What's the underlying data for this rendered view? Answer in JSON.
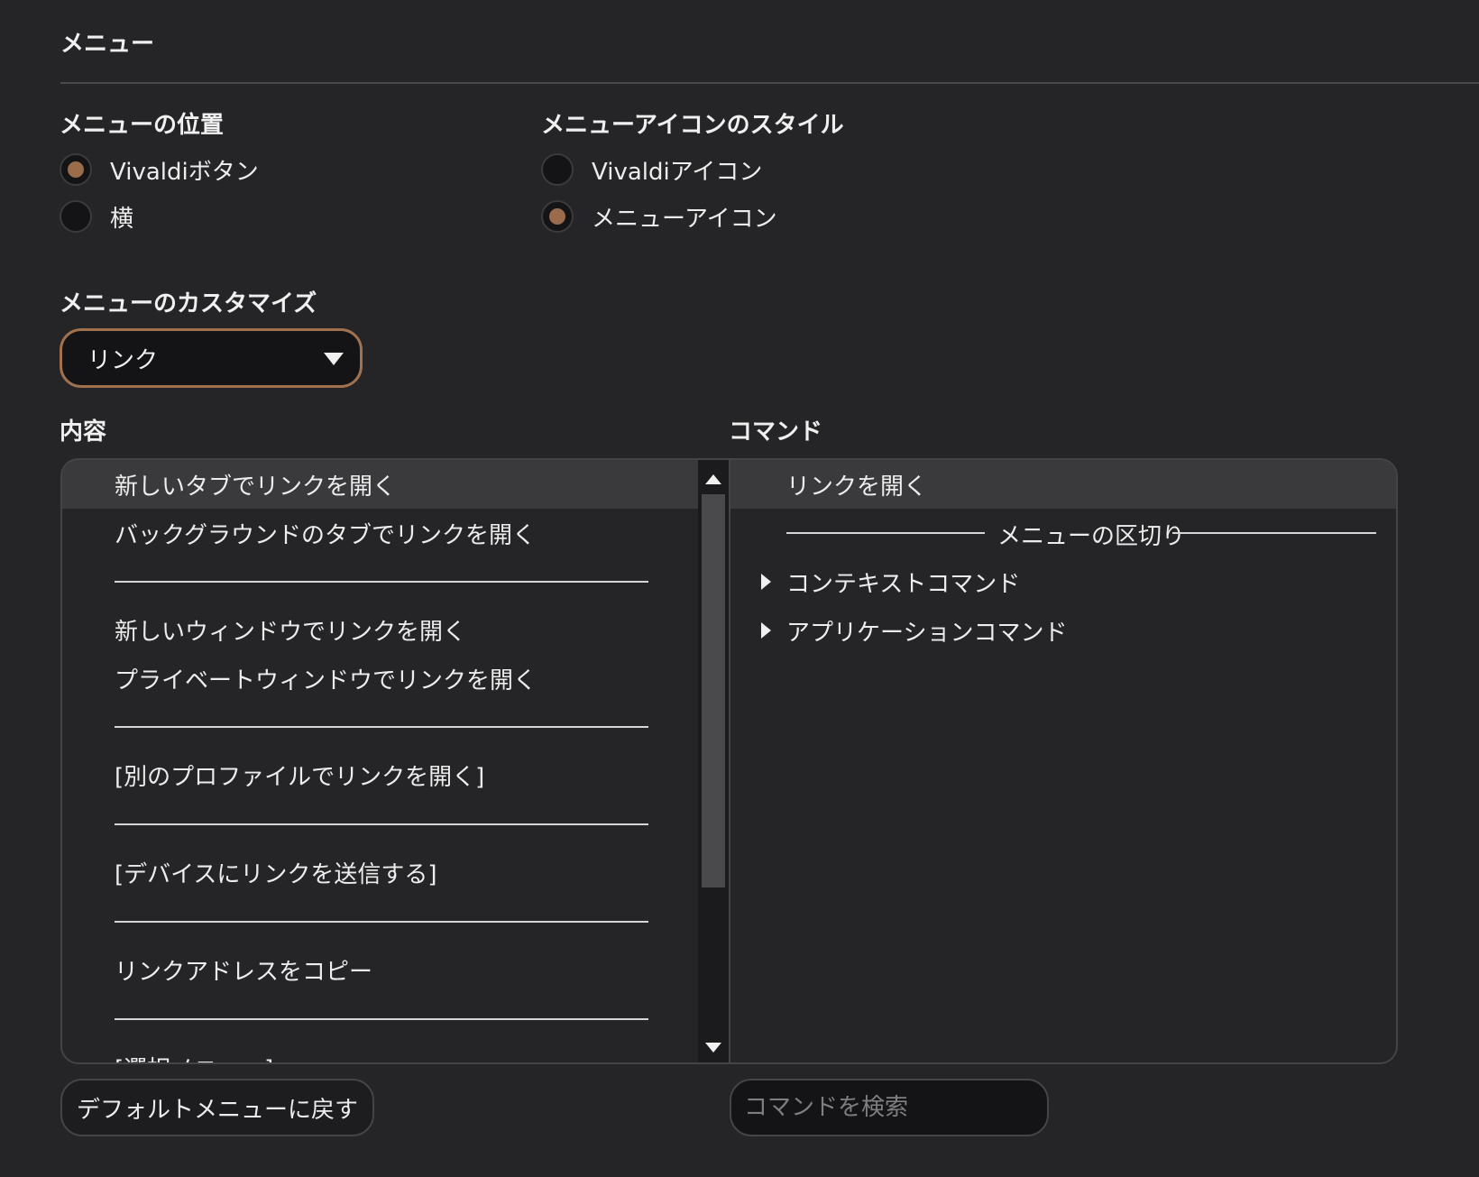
{
  "section": {
    "title": "メニュー"
  },
  "menu_position": {
    "heading": "メニューの位置",
    "options": [
      {
        "label": "Vivaldiボタン",
        "checked": true
      },
      {
        "label": "横",
        "checked": false
      }
    ]
  },
  "menu_icon_style": {
    "heading": "メニューアイコンのスタイル",
    "options": [
      {
        "label": "Vivaldiアイコン",
        "checked": false
      },
      {
        "label": "メニューアイコン",
        "checked": true
      }
    ]
  },
  "customize": {
    "heading": "メニューのカスタマイズ",
    "selected": "リンク"
  },
  "content": {
    "heading": "内容",
    "items": [
      "新しいタブでリンクを開く",
      "バックグラウンドのタブでリンクを開く",
      "新しいウィンドウでリンクを開く",
      "プライベートウィンドウでリンクを開く",
      "[別のプロファイルでリンクを開く]",
      "[デバイスにリンクを送信する]",
      "リンクアドレスをコピー",
      "[選択メニュー]"
    ]
  },
  "commands": {
    "heading": "コマンド",
    "items": [
      "リンクを開く",
      "メニューの区切り",
      "コンテキストコマンド",
      "アプリケーションコマンド"
    ]
  },
  "buttons": {
    "reset": "デフォルトメニューに戻す"
  },
  "search": {
    "placeholder": "コマンドを検索"
  },
  "colors": {
    "accent": "#9a6c4c",
    "background": "#252426"
  }
}
